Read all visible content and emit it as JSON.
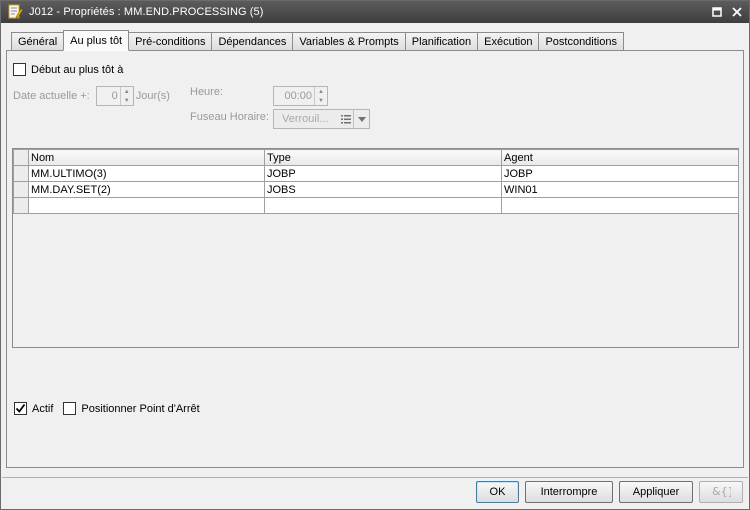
{
  "window": {
    "title": "J012 - Propriétés : MM.END.PROCESSING (5)"
  },
  "tabs": [
    {
      "label": "Général"
    },
    {
      "label": "Au plus tôt"
    },
    {
      "label": "Pré-conditions"
    },
    {
      "label": "Dépendances"
    },
    {
      "label": "Variables & Prompts"
    },
    {
      "label": "Planification"
    },
    {
      "label": "Exécution"
    },
    {
      "label": "Postconditions"
    }
  ],
  "active_tab": "Au plus tôt",
  "earliest": {
    "checkbox_label": "Début au plus tôt à",
    "checked": false,
    "date_label": "Date actuelle +:",
    "days_value": "0",
    "days_unit": "Jour(s)",
    "time_label": "Heure:",
    "time_value": "00:00",
    "timezone_label": "Fuseau Horaire:",
    "timezone_placeholder": "Verrouil..."
  },
  "grid": {
    "columns": [
      "Nom",
      "Type",
      "Agent"
    ],
    "rows": [
      [
        "MM.ULTIMO(3)",
        "JOBP",
        "JOBP"
      ],
      [
        "MM.DAY.SET(2)",
        "JOBS",
        "WIN01"
      ],
      [
        "",
        "",
        ""
      ]
    ]
  },
  "options": {
    "actif_label": "Actif",
    "actif_checked": true,
    "breakpoint_label": "Positionner Point d'Arrêt",
    "breakpoint_checked": false
  },
  "buttons": {
    "ok": "OK",
    "cancel": "Interrompre",
    "apply": "Appliquer"
  },
  "colors": {
    "titlebar": "#4a4a4a",
    "panel": "#f0f0f0",
    "default_button_border": "#3c7fb1"
  }
}
